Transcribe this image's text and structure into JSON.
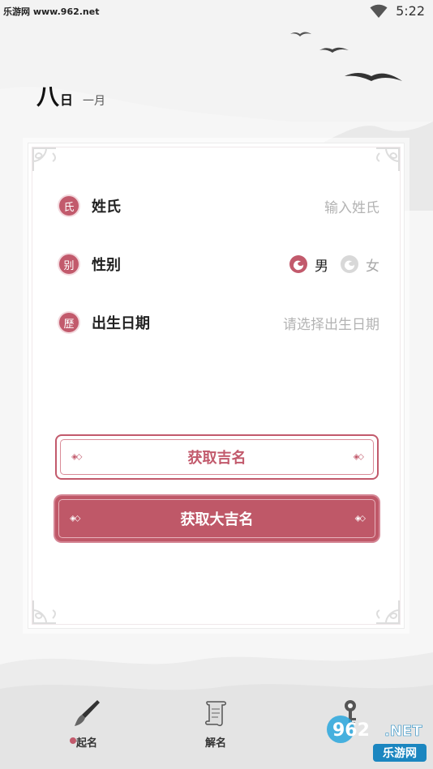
{
  "status_bar": {
    "watermark": "乐游网 www.962.net",
    "time": "5:22",
    "wifi_icon": "wifi-icon"
  },
  "date_header": {
    "day": "八",
    "day_suffix": "日",
    "month": "一月"
  },
  "form": {
    "surname": {
      "seal": "氏",
      "label": "姓氏",
      "placeholder": "输入姓氏"
    },
    "gender": {
      "seal": "别",
      "label": "性别",
      "options": [
        {
          "label": "男",
          "selected": true
        },
        {
          "label": "女",
          "selected": false
        }
      ]
    },
    "birth_date": {
      "seal": "歷",
      "label": "出生日期",
      "placeholder": "请选择出生日期"
    }
  },
  "buttons": {
    "get_good_name": "获取吉名",
    "get_great_name": "获取大吉名",
    "diamond": "◈◇"
  },
  "bottom_nav": [
    {
      "label": "起名",
      "icon": "brush-icon",
      "active": true
    },
    {
      "label": "解名",
      "icon": "scroll-icon",
      "active": false
    },
    {
      "label": "",
      "icon": "key-icon",
      "active": false
    }
  ],
  "corner_watermark": {
    "logo_main": "962",
    "logo_tld": ".NET",
    "logo_sub": "乐游网"
  },
  "colors": {
    "accent": "#c25a6c",
    "button_fill": "#bf5868",
    "background": "#f6f6f6",
    "card": "#ffffff",
    "placeholder": "#b3b3b3"
  }
}
